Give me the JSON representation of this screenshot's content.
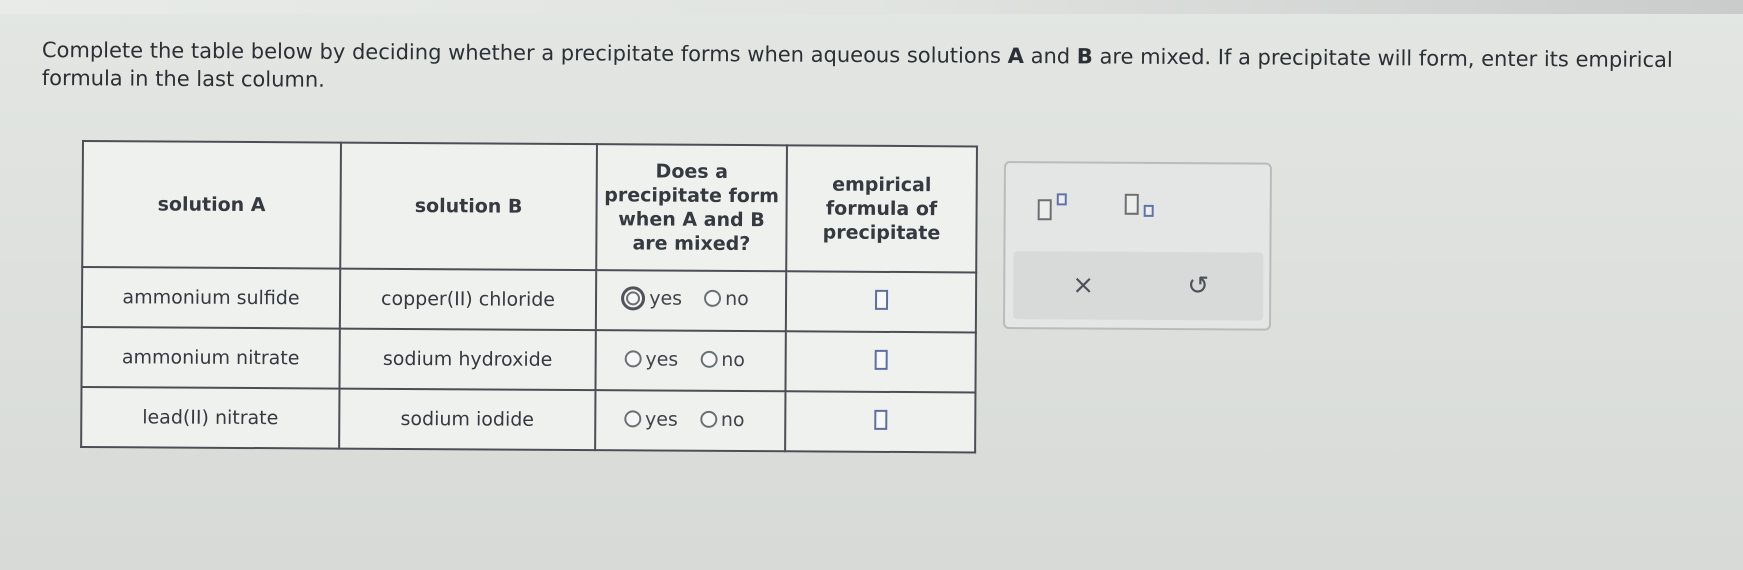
{
  "instructions": {
    "part1": "Complete the table below by deciding whether a precipitate forms when aqueous solutions ",
    "a": "A",
    "part2": " and ",
    "b": "B",
    "part3": " are mixed. If a precipitate will form, enter its empirical formula in the last column."
  },
  "table": {
    "headers": {
      "solution_a": "solution A",
      "solution_b": "solution B",
      "precipitate_q": "Does a precipitate form when A and B are mixed?",
      "formula": "empirical formula of precipitate"
    },
    "rows": [
      {
        "a": "ammonium sulfide",
        "b": "copper(II) chloride",
        "yes": "yes",
        "no": "no",
        "formula_value": ""
      },
      {
        "a": "ammonium nitrate",
        "b": "sodium hydroxide",
        "yes": "yes",
        "no": "no",
        "formula_value": ""
      },
      {
        "a": "lead(II) nitrate",
        "b": "sodium iodide",
        "yes": "yes",
        "no": "no",
        "formula_value": ""
      }
    ]
  },
  "palette": {
    "superscript_icon": "superscript-icon",
    "subscript_icon": "subscript-icon",
    "clear_symbol": "×",
    "undo_symbol": "↺"
  }
}
